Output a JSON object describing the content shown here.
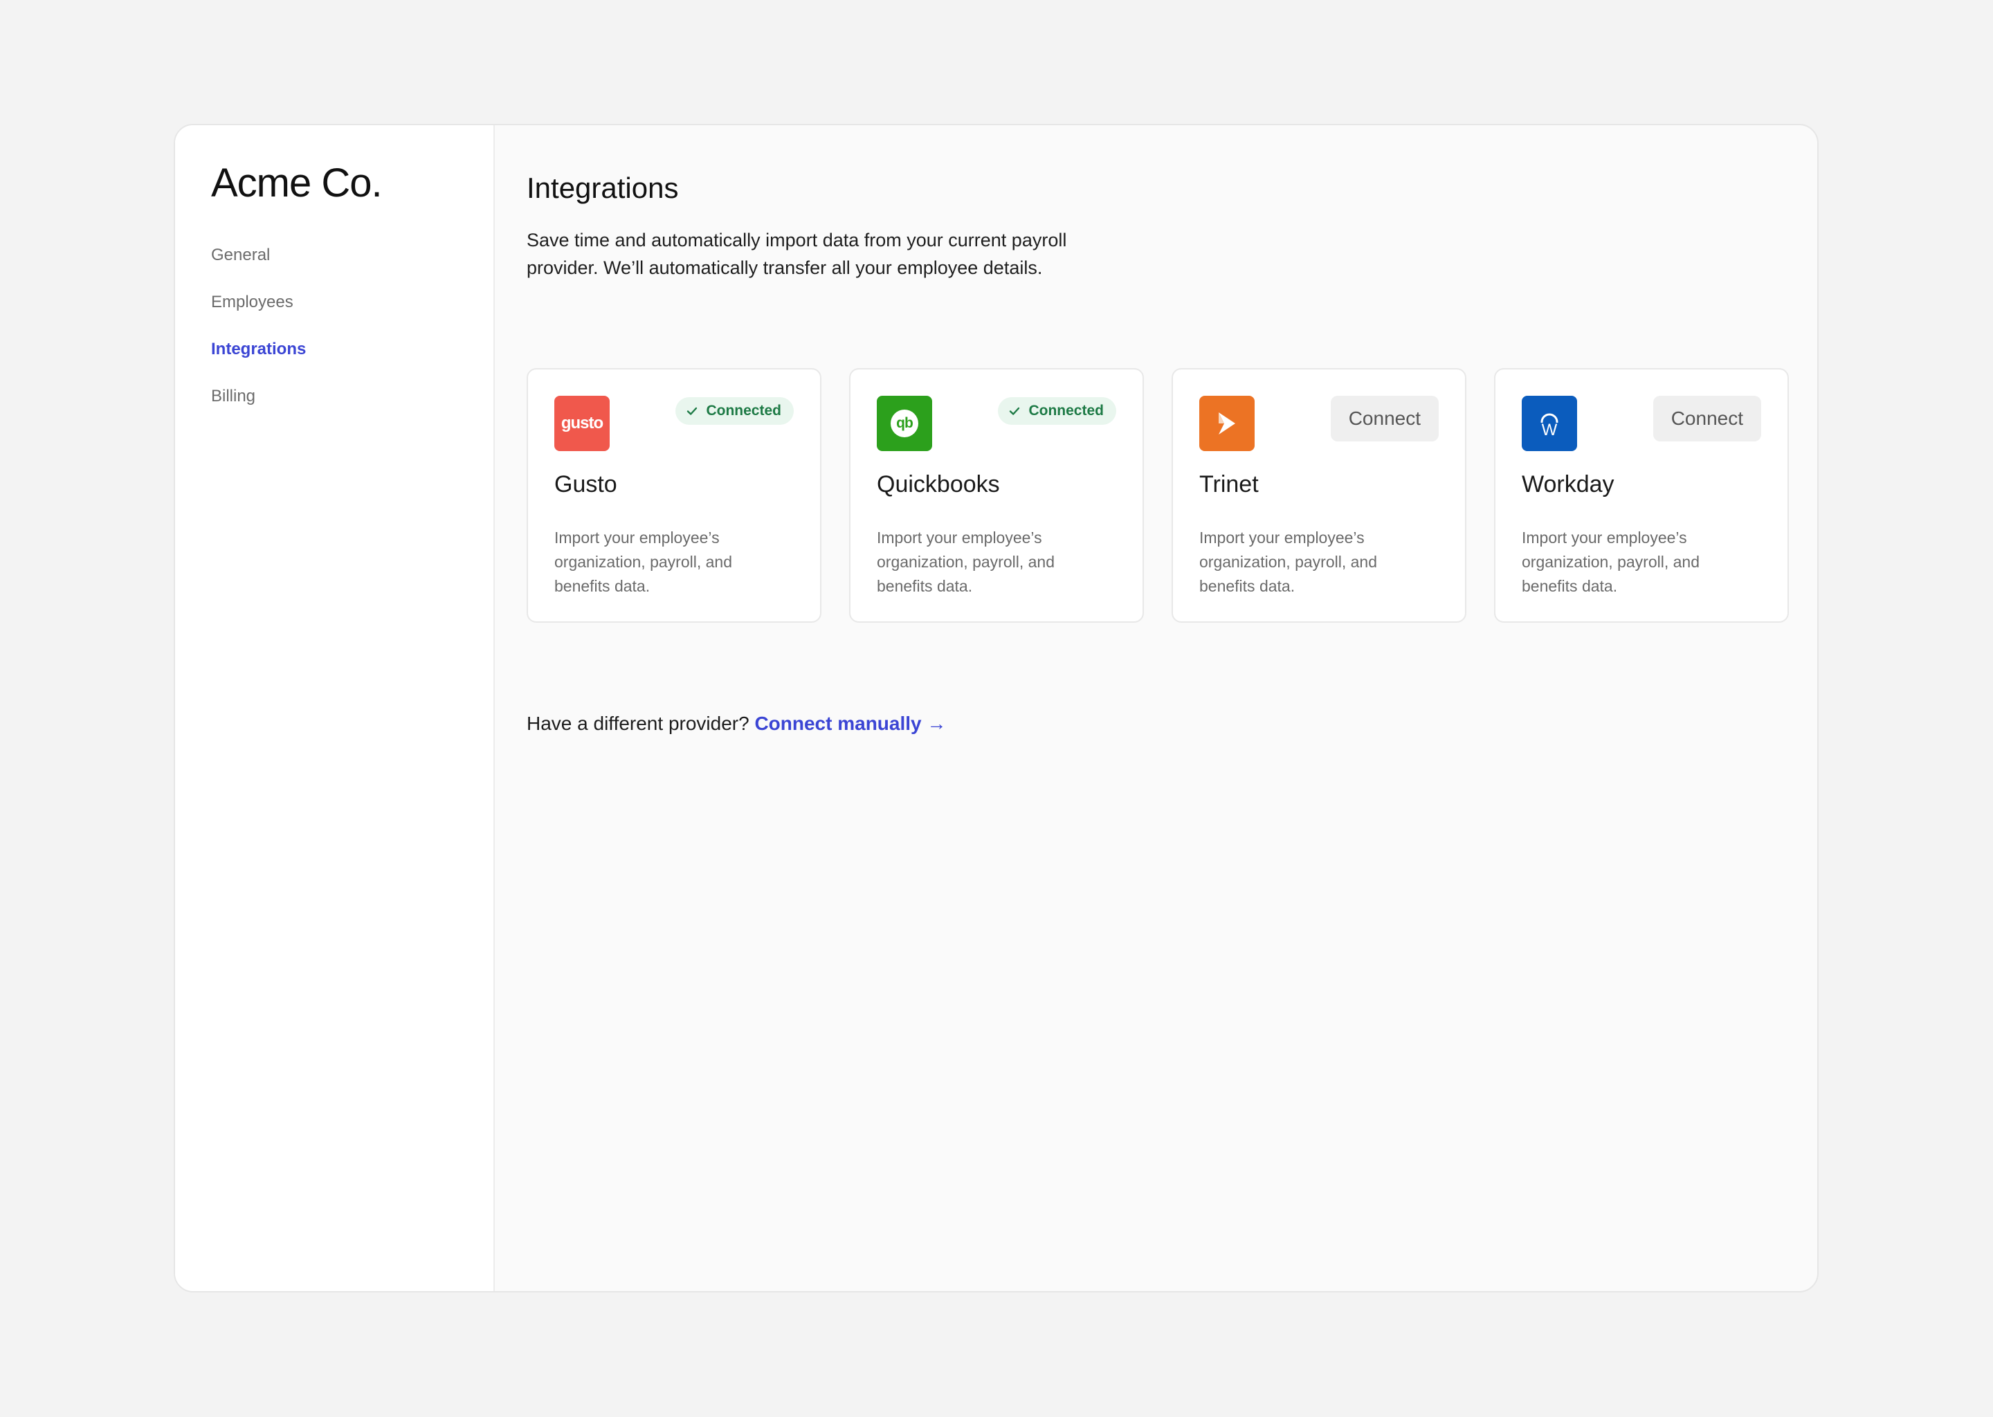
{
  "sidebar": {
    "brand": "Acme Co.",
    "items": [
      {
        "label": "General"
      },
      {
        "label": "Employees"
      },
      {
        "label": "Integrations"
      },
      {
        "label": "Billing"
      }
    ]
  },
  "main": {
    "title": "Integrations",
    "description": "Save time and automatically import data from your current payroll provider. We’ll automatically transfer all your employee details.",
    "cards": [
      {
        "name": "Gusto",
        "logo_text": "gusto",
        "logo_color": "#f0584c",
        "status": "Connected",
        "description": "Import your employee’s organization, payroll, and benefits data."
      },
      {
        "name": "Quickbooks",
        "logo_text": "qb",
        "logo_color": "#2ca01c",
        "status": "Connected",
        "description": "Import your employee’s organization, payroll, and benefits data."
      },
      {
        "name": "Trinet",
        "logo_color": "#ec7324",
        "action": "Connect",
        "description": "Import your employee’s organization, payroll, and benefits data."
      },
      {
        "name": "Workday",
        "logo_text": "W",
        "logo_color": "#0b5cbd",
        "action": "Connect",
        "description": "Import your employee’s organization, payroll, and benefits data."
      }
    ],
    "footer": {
      "prompt": "Have a different provider?",
      "link_label": "Connect manually →"
    }
  },
  "colors": {
    "accent": "#3b45d4",
    "connected_text": "#1d7a45",
    "connected_bg": "#e9f6ee"
  }
}
